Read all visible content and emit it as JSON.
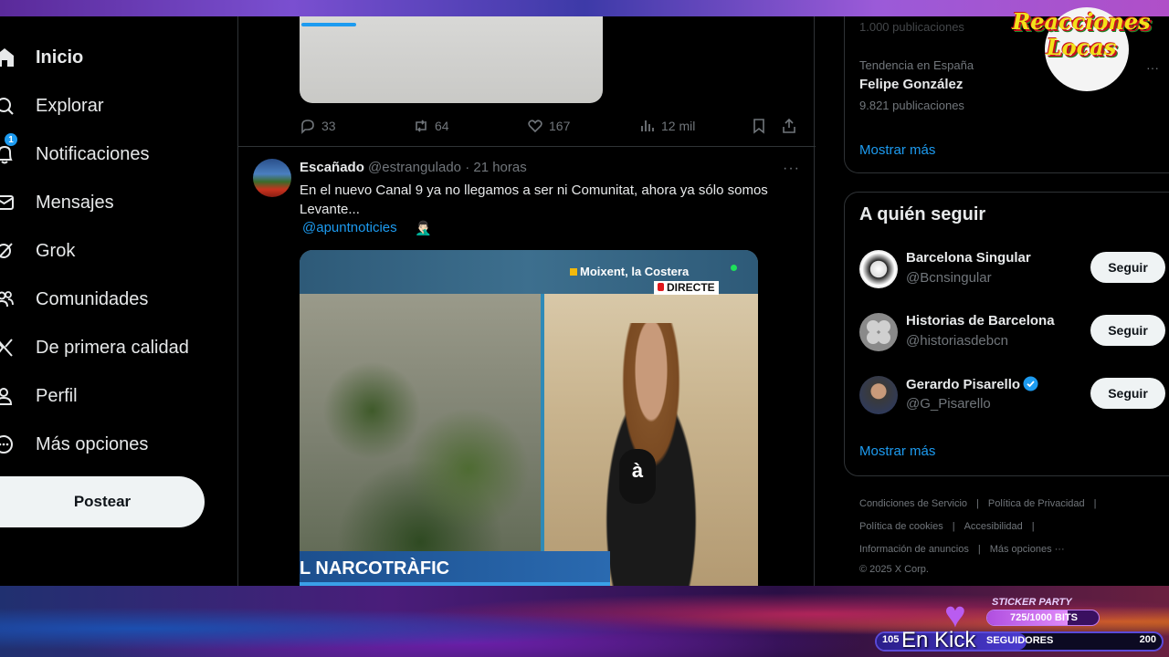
{
  "nav": {
    "items": [
      {
        "label": "Inicio",
        "icon": "home-icon",
        "active": true
      },
      {
        "label": "Explorar",
        "icon": "search-icon"
      },
      {
        "label": "Notificaciones",
        "icon": "bell-icon",
        "badge": "1"
      },
      {
        "label": "Mensajes",
        "icon": "envelope-icon"
      },
      {
        "label": "Grok",
        "icon": "grok-icon"
      },
      {
        "label": "Comunidades",
        "icon": "people-icon"
      },
      {
        "label": "De primera calidad",
        "icon": "x-logo-icon"
      },
      {
        "label": "Perfil",
        "icon": "person-icon"
      },
      {
        "label": "Más opciones",
        "icon": "more-circle-icon"
      }
    ],
    "post_label": "Postear"
  },
  "prev_tweet": {
    "replies": "33",
    "retweets": "64",
    "likes": "167",
    "views": "12 mil"
  },
  "tweet": {
    "name": "Escañado",
    "handle": "@estrangulado",
    "time": "21 horas",
    "text": "En el nuevo Canal 9 ya no llegamos a ser ni Comunitat, ahora ya sólo somos Levante...",
    "mention": "@apuntnoticies",
    "emoji": "🤦🏻‍♂️",
    "video": {
      "location": "Moixent, la Costera",
      "live_label": "DIRECTE",
      "lower_third": "L NARCOTRÀFIC",
      "mic_logo": "à"
    }
  },
  "trends": {
    "faded_count": "1.000 publicaciones",
    "context": "Tendencia en España",
    "title": "Felipe González",
    "count": "9.821 publicaciones",
    "show_more": "Mostrar más"
  },
  "follow": {
    "title": "A quién seguir",
    "button_label": "Seguir",
    "accounts": [
      {
        "name": "Barcelona Singular",
        "handle": "@Bcnsingular"
      },
      {
        "name": "Historias de Barcelona",
        "handle": "@historiasdebcn"
      },
      {
        "name": "Gerardo Pisarello",
        "handle": "@G_Pisarello",
        "verified": true
      }
    ],
    "show_more": "Mostrar más"
  },
  "footer": {
    "links": [
      "Condiciones de Servicio",
      "Política de Privacidad",
      "Política de cookies",
      "Accesibilidad",
      "Información de anuncios",
      "Más opciones ···",
      "© 2025 X Corp."
    ]
  },
  "overlay": {
    "logo_line1": "Reacciones",
    "logo_line2": "Locas",
    "sticker_title": "STICKER PARTY",
    "sticker_progress": "725/1000 BITS",
    "sticker_fraction": 0.725,
    "followers_current": "105",
    "followers_label": "SEGUIDORES",
    "followers_goal": "200",
    "followers_fraction": 0.525,
    "kick_text": "En Kick"
  },
  "colors": {
    "accent": "#1d9bf0",
    "background": "#000000",
    "border": "#2f3336",
    "muted": "#71767b"
  }
}
